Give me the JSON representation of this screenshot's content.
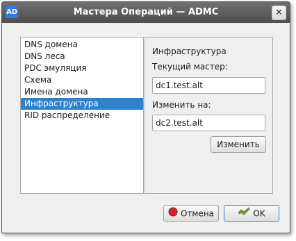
{
  "window": {
    "title": "Мастера Операций — ADMC",
    "app_icon_text": "AD",
    "close_glyph": "✕"
  },
  "roles": [
    {
      "label": "DNS домена",
      "selected": false
    },
    {
      "label": "DNS леса",
      "selected": false
    },
    {
      "label": "PDC эмуляция",
      "selected": false
    },
    {
      "label": "Схема",
      "selected": false
    },
    {
      "label": "Имена домена",
      "selected": false
    },
    {
      "label": "Инфраструктура",
      "selected": true
    },
    {
      "label": "RID распределение",
      "selected": false
    }
  ],
  "detail": {
    "role_name": "Инфраструктура",
    "current_label": "Текущий мастер:",
    "current_value": "dc1.test.alt",
    "change_to_label": "Изменить на:",
    "change_to_value": "dc2.test.alt",
    "change_button": "Изменить"
  },
  "buttons": {
    "cancel_label": "Отмена",
    "ok_label": "OK"
  },
  "colors": {
    "selection": "#2e82cc",
    "titlebar": "#5a5a5a",
    "cancel_icon": "#e02020",
    "ok_icon": "#7a9b3b"
  }
}
